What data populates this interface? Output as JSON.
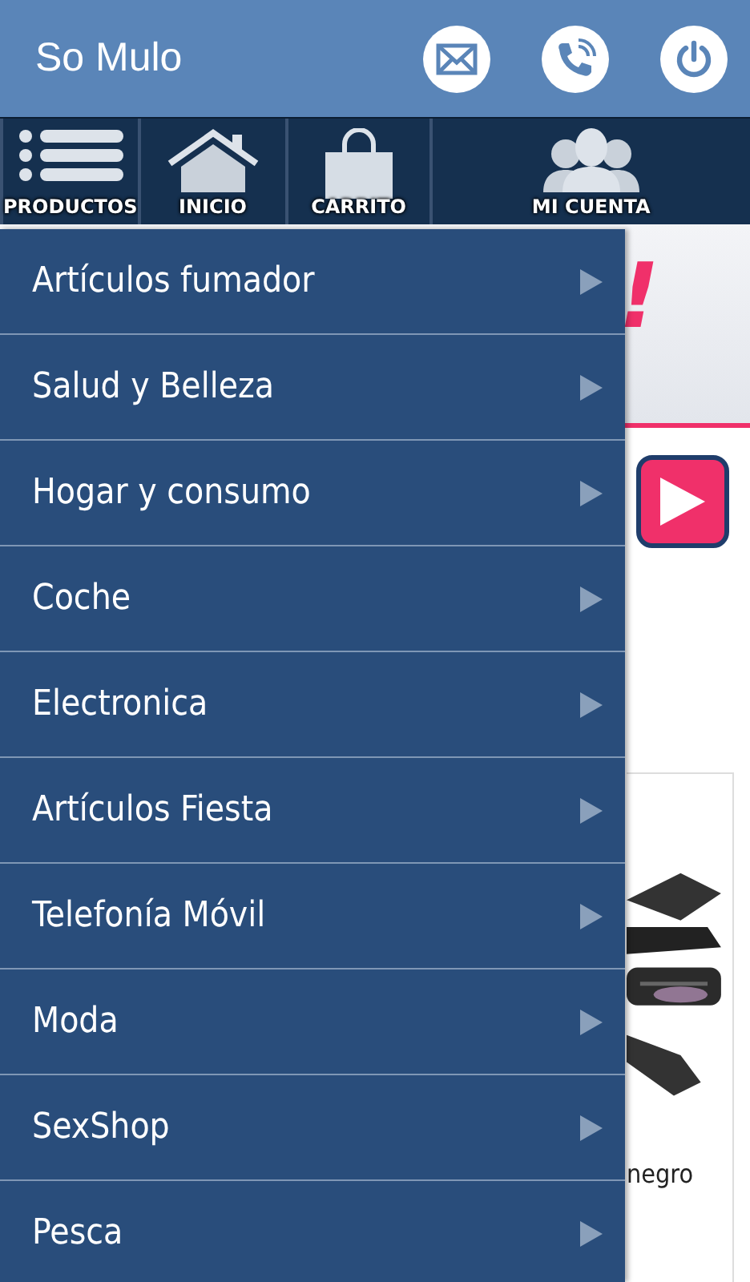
{
  "header": {
    "title": "So Mulo"
  },
  "nav_tabs": [
    {
      "label": "PRODUCTOS",
      "kind": "list"
    },
    {
      "label": "INICIO",
      "kind": "home"
    },
    {
      "label": "CARRITO",
      "kind": "bag"
    },
    {
      "label": "MI CUENTA",
      "kind": "people"
    }
  ],
  "content": {
    "banner_mark": "!",
    "product_caption": "negro"
  },
  "menu": [
    {
      "label": "Artículos fumador"
    },
    {
      "label": "Salud y Belleza"
    },
    {
      "label": "Hogar y consumo"
    },
    {
      "label": "Coche"
    },
    {
      "label": "Electronica"
    },
    {
      "label": "Artículos Fiesta"
    },
    {
      "label": "Telefonía Móvil"
    },
    {
      "label": "Moda"
    },
    {
      "label": "SexShop"
    },
    {
      "label": "Pesca"
    }
  ]
}
